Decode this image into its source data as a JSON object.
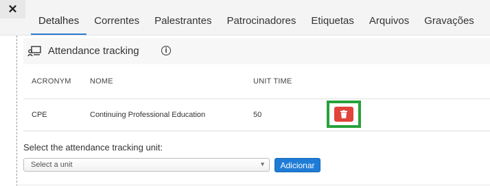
{
  "window": {
    "close_glyph": "✕"
  },
  "tabs": [
    {
      "label": "Detalhes",
      "active": true
    },
    {
      "label": "Correntes",
      "active": false
    },
    {
      "label": "Palestrantes",
      "active": false
    },
    {
      "label": "Patrocinadores",
      "active": false
    },
    {
      "label": "Etiquetas",
      "active": false
    },
    {
      "label": "Arquivos",
      "active": false
    },
    {
      "label": "Gravações",
      "active": false
    }
  ],
  "section": {
    "title": "Attendance tracking",
    "icon": "presentation-user-icon",
    "info_glyph": "i"
  },
  "table": {
    "columns": [
      "ACRONYM",
      "NOME",
      "UNIT TIME"
    ],
    "rows": [
      {
        "acronym": "CPE",
        "name": "Continuing Professional Education",
        "unit_time": "50",
        "action_icon": "trash-icon"
      }
    ]
  },
  "form": {
    "label": "Select the attendance tracking unit:",
    "select_placeholder": "Select a unit",
    "add_button": "Adicionar"
  },
  "colors": {
    "accent": "#2a7ad1",
    "delete": "#e0443a",
    "highlight": "#27a23a",
    "primary_button": "#1f7cd6"
  }
}
